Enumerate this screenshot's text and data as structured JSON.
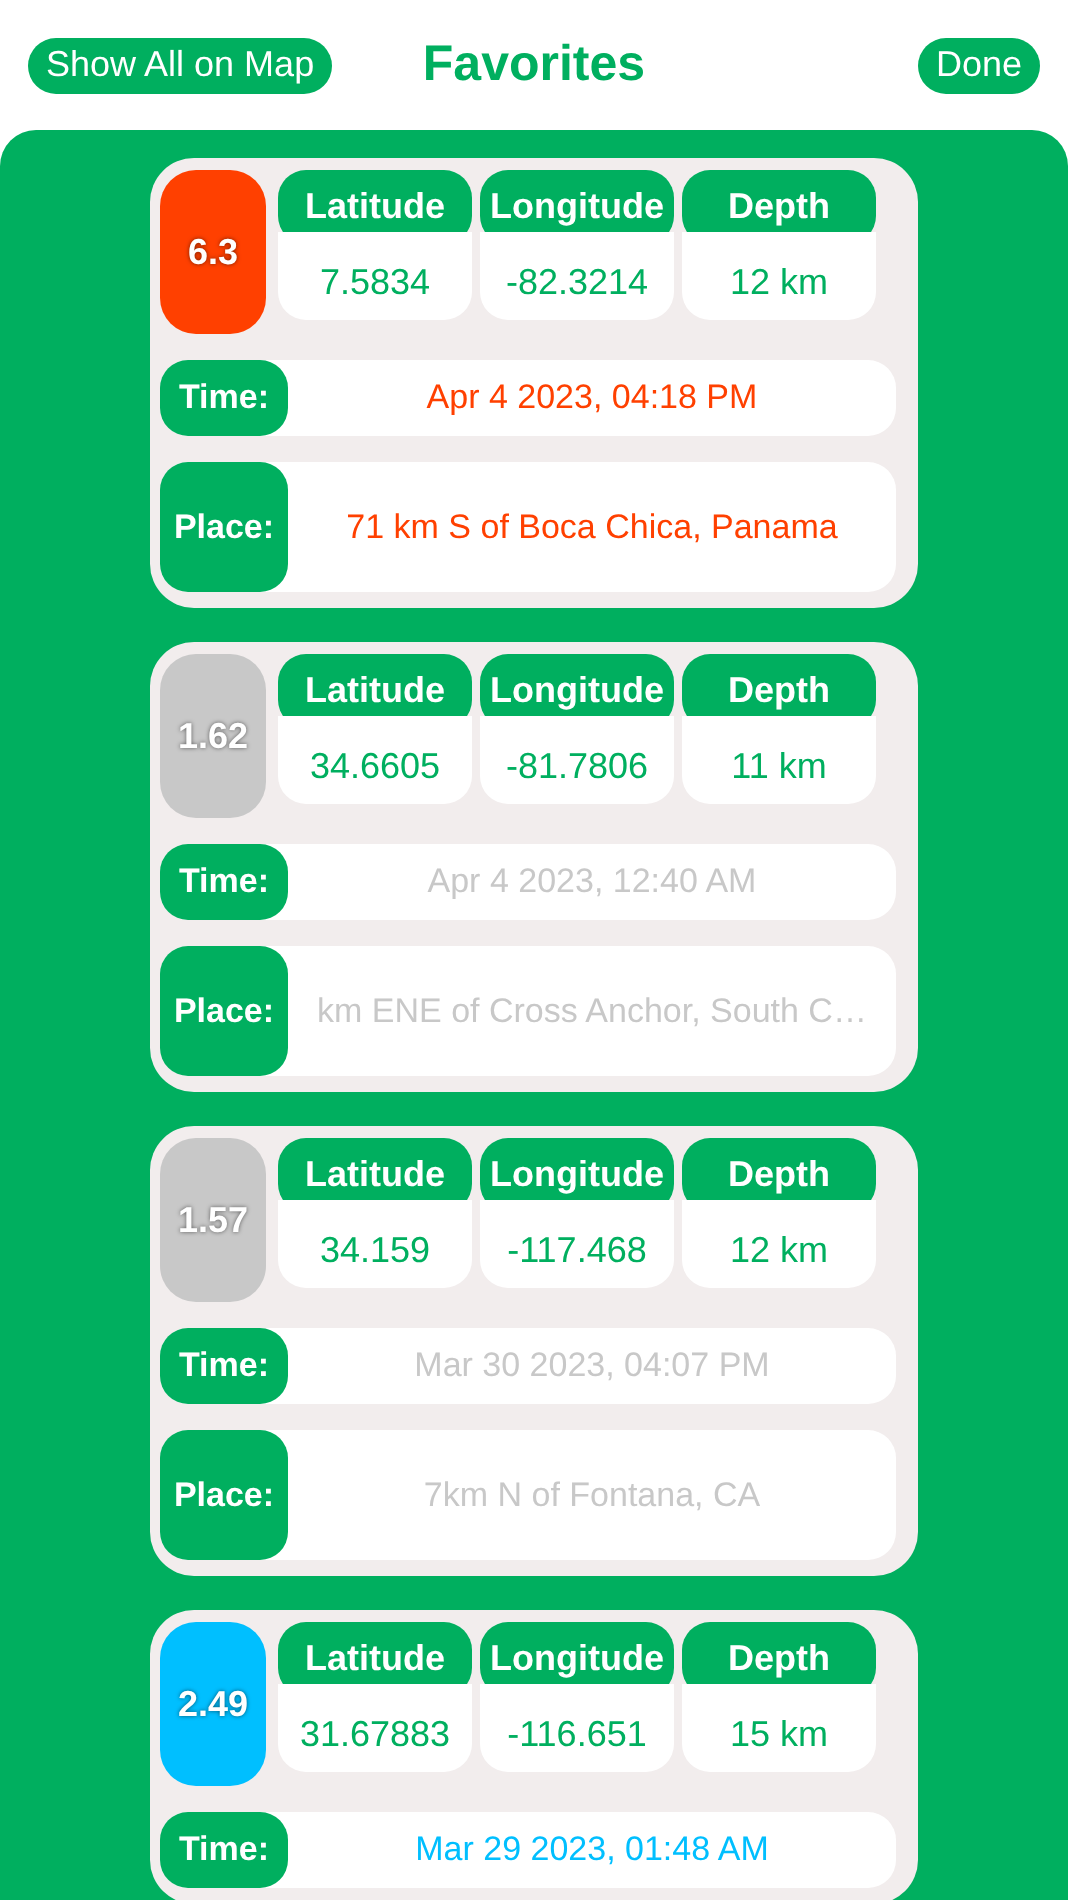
{
  "header": {
    "left_button": "Show All on Map",
    "title": "Favorites",
    "right_button": "Done"
  },
  "quakes": [
    {
      "magnitude": "6.3",
      "color": "#ff4000",
      "columns": [
        {
          "label": "Latitude",
          "value": "7.5834"
        },
        {
          "label": "Longitude",
          "value": "-82.3214"
        },
        {
          "label": "Depth",
          "value": "12 km"
        }
      ],
      "time_label": "Time:",
      "time": "Apr 4 2023, 04:18 PM",
      "place_label": "Place:",
      "place": "71 km S of Boca Chica, Panama"
    },
    {
      "magnitude": "1.62",
      "color": "#c8c8c8",
      "columns": [
        {
          "label": "Latitude",
          "value": "34.6605"
        },
        {
          "label": "Longitude",
          "value": "-81.7806"
        },
        {
          "label": "Depth",
          "value": "11 km"
        }
      ],
      "time_label": "Time:",
      "time": "Apr 4 2023, 12:40 AM",
      "place_label": "Place:",
      "place": "km ENE of Cross Anchor, South C…"
    },
    {
      "magnitude": "1.57",
      "color": "#c8c8c8",
      "columns": [
        {
          "label": "Latitude",
          "value": "34.159"
        },
        {
          "label": "Longitude",
          "value": "-117.468"
        },
        {
          "label": "Depth",
          "value": "12 km"
        }
      ],
      "time_label": "Time:",
      "time": "Mar 30 2023, 04:07 PM",
      "place_label": "Place:",
      "place": "7km N of Fontana, CA"
    },
    {
      "magnitude": "2.49",
      "color": "#00bfff",
      "columns": [
        {
          "label": "Latitude",
          "value": "31.67883"
        },
        {
          "label": "Longitude",
          "value": "-116.651"
        },
        {
          "label": "Depth",
          "value": "15 km"
        }
      ],
      "time_label": "Time:",
      "time": "Mar 29 2023, 01:48 AM"
    }
  ]
}
